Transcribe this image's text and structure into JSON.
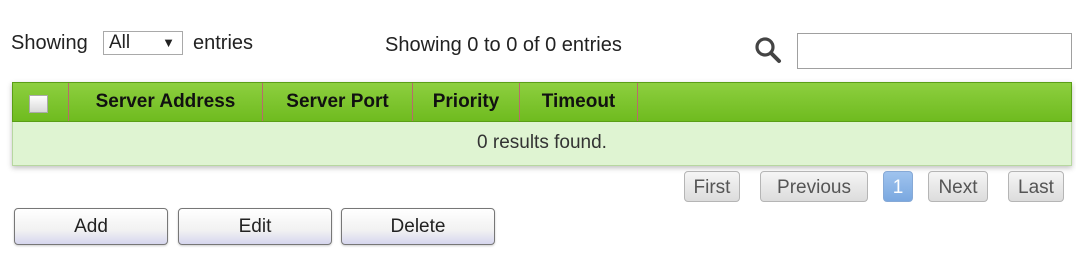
{
  "entries": {
    "prefix": "Showing",
    "selected": "All",
    "suffix": "entries"
  },
  "info": "Showing 0 to 0 of 0 entries",
  "search": {
    "value": "",
    "placeholder": ""
  },
  "table": {
    "columns": [
      "Server Address",
      "Server Port",
      "Priority",
      "Timeout"
    ],
    "empty_message": "0 results found."
  },
  "pagination": {
    "first": "First",
    "previous": "Previous",
    "current": "1",
    "next": "Next",
    "last": "Last"
  },
  "actions": {
    "add": "Add",
    "edit": "Edit",
    "delete": "Delete"
  },
  "colors": {
    "header_green": "#7cc42e",
    "row_green": "#dff4d2",
    "page_active": "#8cb6e8"
  },
  "icons": {
    "search": "search-icon",
    "caret": "caret-down-icon"
  }
}
